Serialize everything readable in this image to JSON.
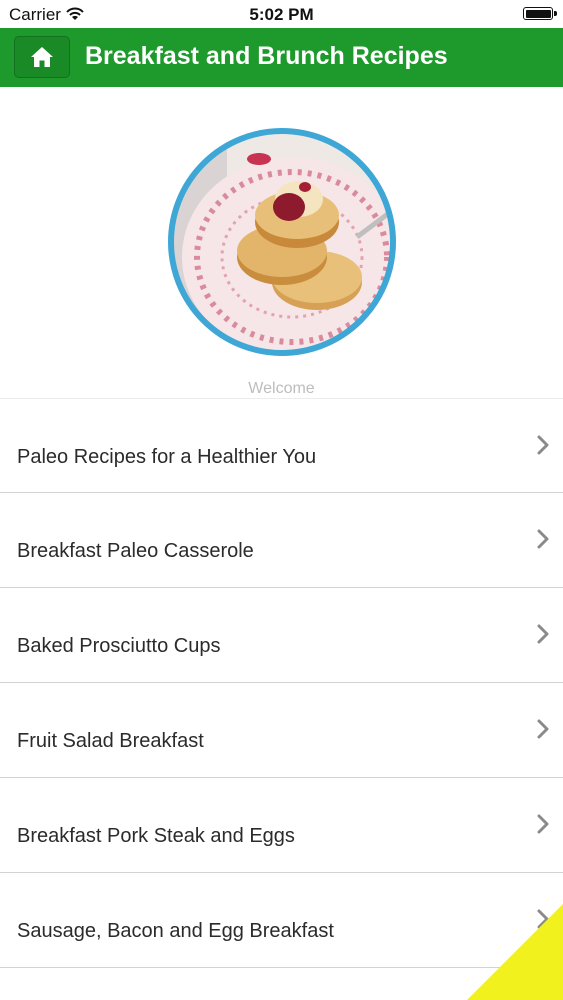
{
  "status_bar": {
    "carrier": "Carrier",
    "time": "5:02 PM",
    "wifi_icon": "wifi-icon",
    "battery_icon": "battery-icon"
  },
  "nav": {
    "title": "Breakfast and Brunch Recipes",
    "home_icon": "home-icon",
    "bar_color": "#1e9a2c"
  },
  "hero": {
    "image": "pancakes-with-jam-photo",
    "ring_color": "#3ea7d6",
    "caption": "Welcome"
  },
  "recipes": [
    {
      "label": "Paleo Recipes for a Healthier You"
    },
    {
      "label": "Breakfast Paleo Casserole"
    },
    {
      "label": "Baked Prosciutto Cups"
    },
    {
      "label": "Fruit Salad Breakfast"
    },
    {
      "label": "Breakfast Pork Steak and Eggs"
    },
    {
      "label": "Sausage, Bacon and Egg Breakfast"
    }
  ],
  "chevron_icon": "chevron-right-icon",
  "corner_accent_color": "#f1f21d"
}
